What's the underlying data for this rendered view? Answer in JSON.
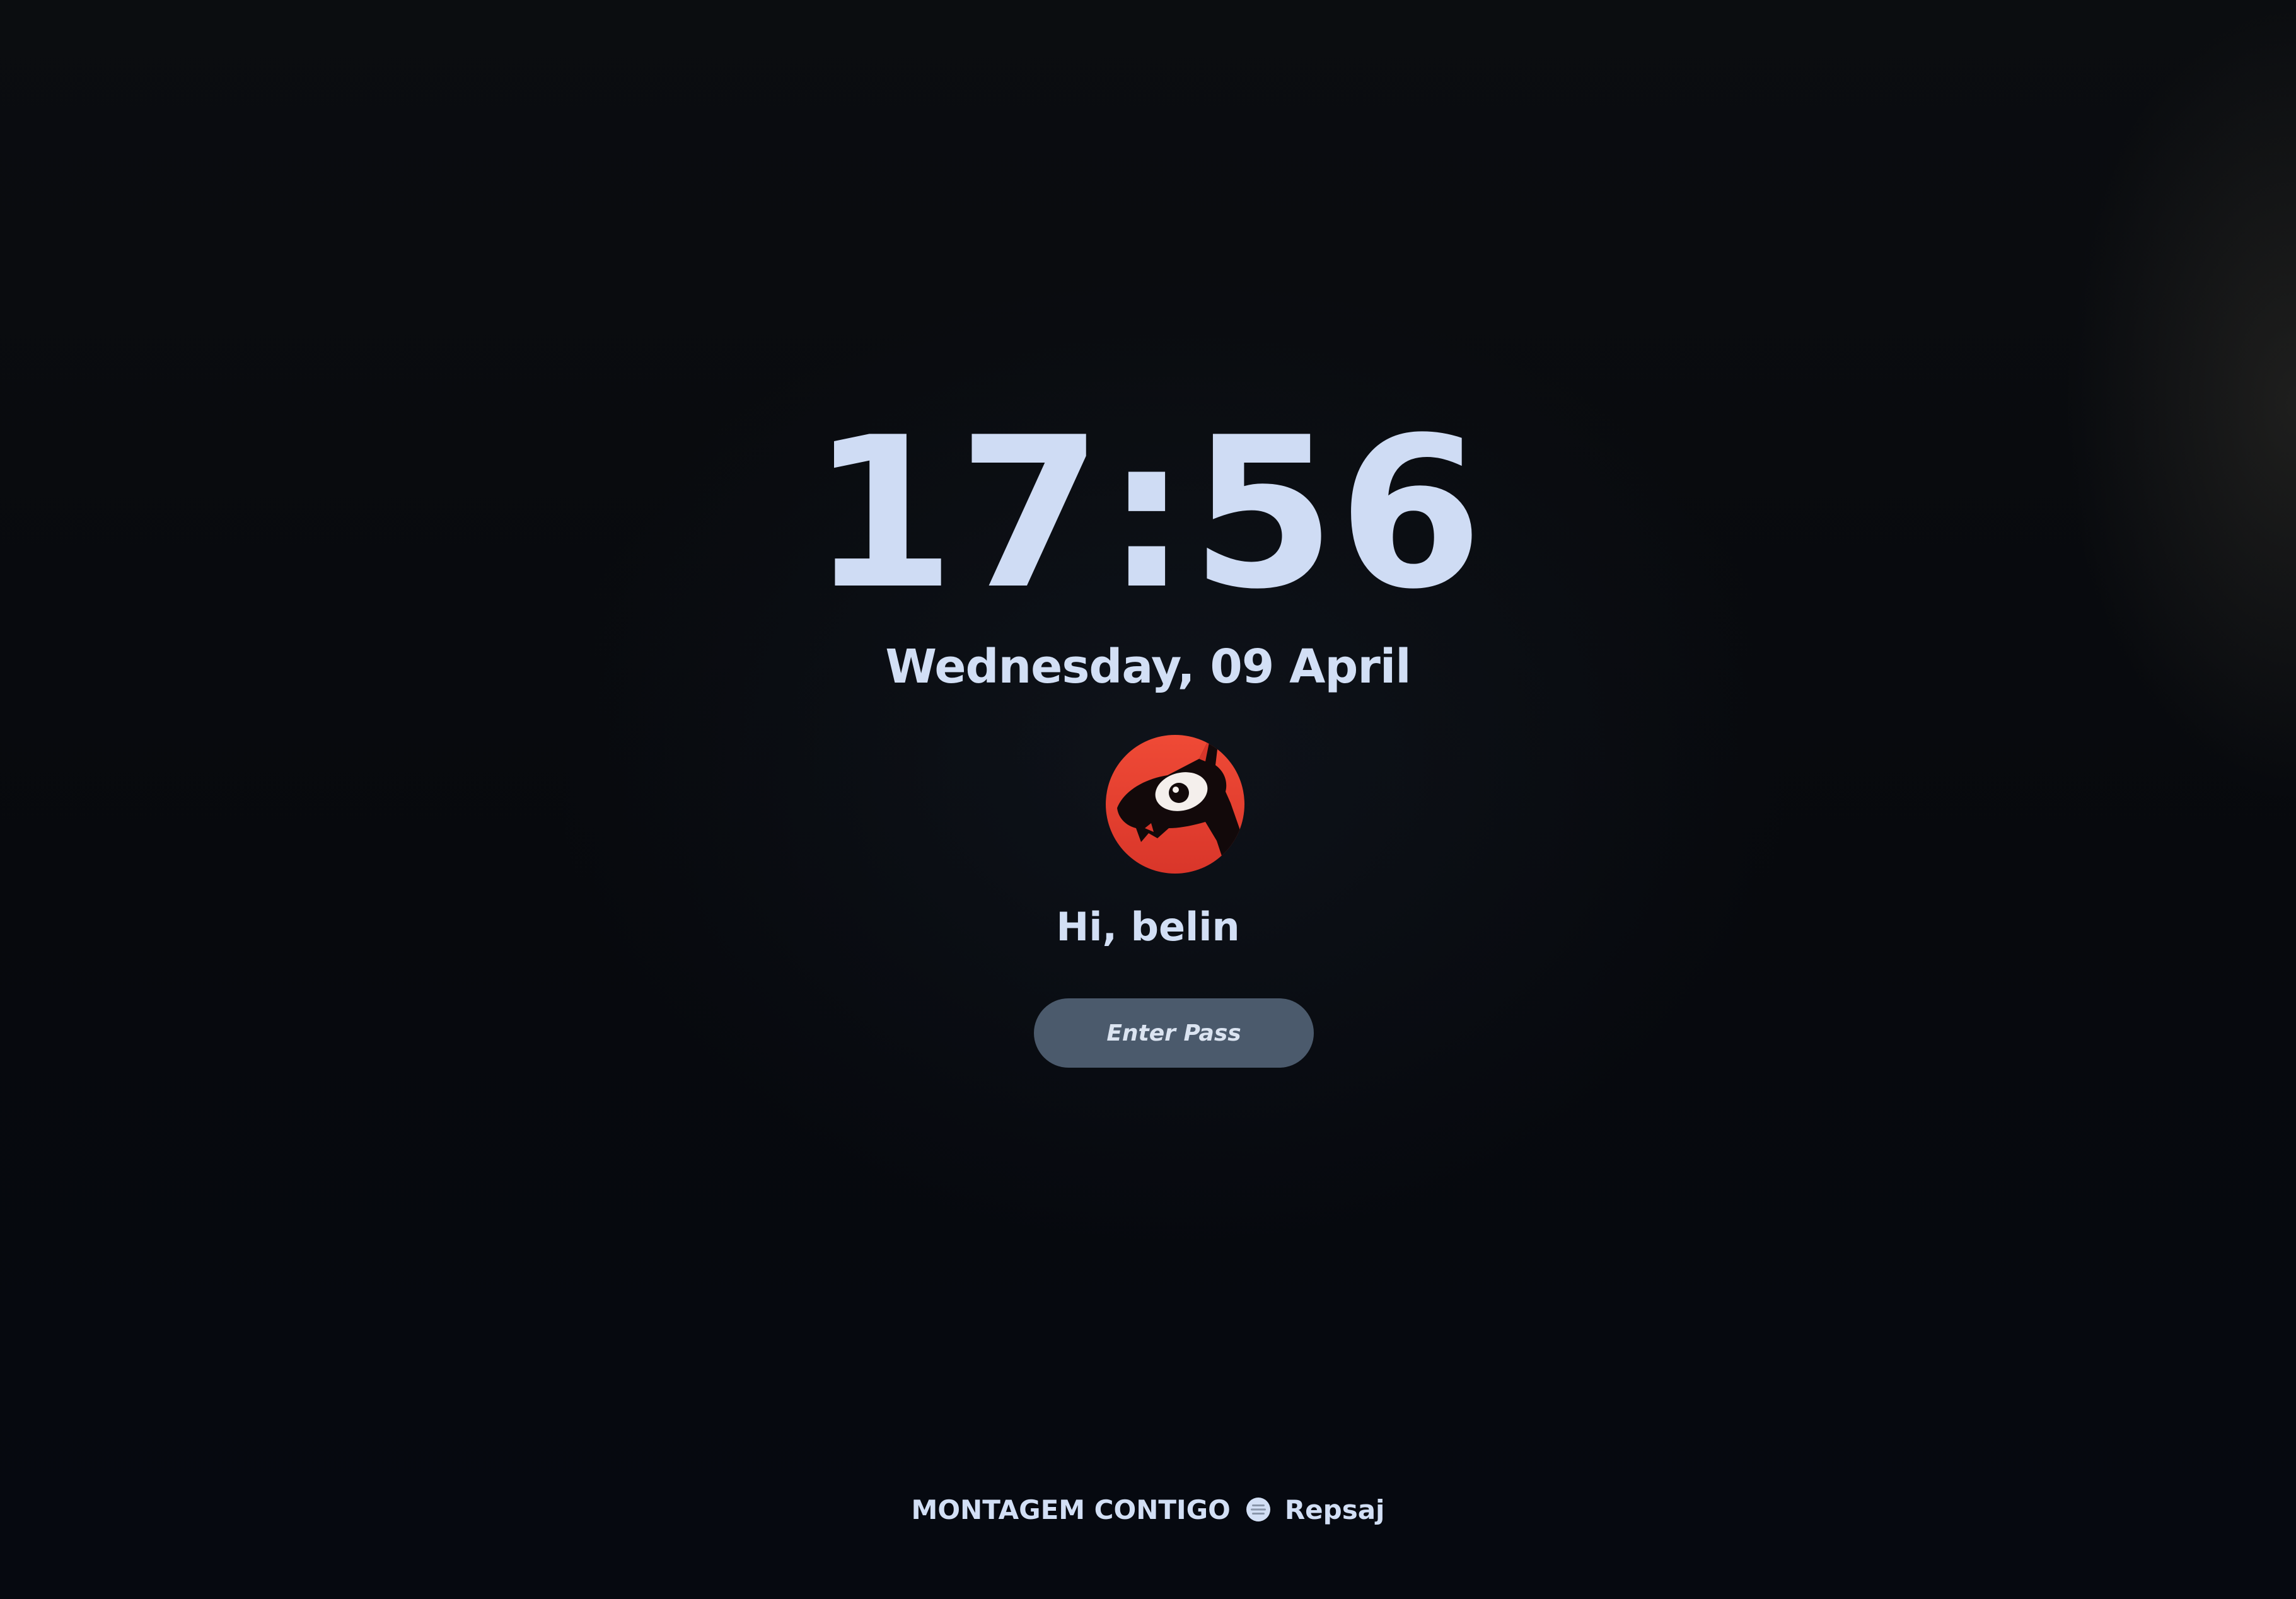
{
  "lockscreen": {
    "time": "17:56",
    "date": "Wednesday, 09 April",
    "greeting": "Hi, belin",
    "password_placeholder": "Enter Pass",
    "avatar_icon": "red-creature-avatar-icon"
  },
  "footer": {
    "left_text": "MONTAGEM CONTIGO",
    "separator_icon": "music-disc-icon",
    "right_text": "Repsaj"
  },
  "colors": {
    "background": "#080a0e",
    "text": "#d2dff5",
    "input_bg": "#4b5a6c",
    "avatar_red": "#e5402f"
  }
}
